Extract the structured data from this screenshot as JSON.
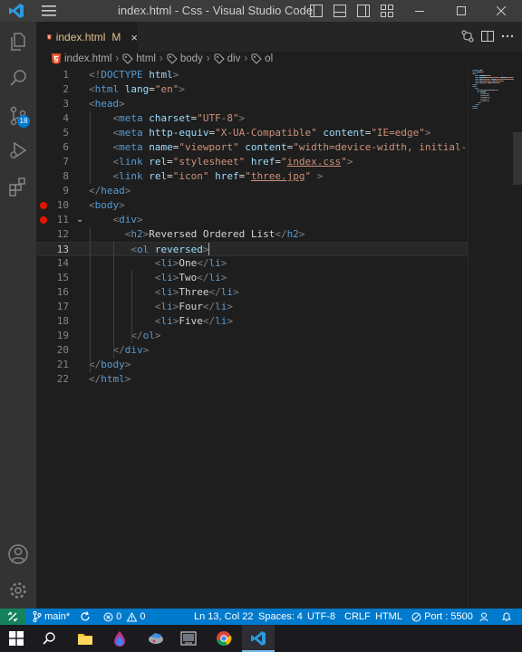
{
  "titlebar": {
    "title": "index.html - Css - Visual Studio Code"
  },
  "tab": {
    "label": "index.html",
    "modified": "M",
    "close": "×"
  },
  "breadcrumb": [
    "index.html",
    "html",
    "body",
    "div",
    "ol"
  ],
  "editor": {
    "current_line": 13,
    "line_numbers": [
      "1",
      "2",
      "3",
      "4",
      "5",
      "6",
      "7",
      "8",
      "9",
      "10",
      "11",
      "12",
      "13",
      "14",
      "15",
      "16",
      "17",
      "18",
      "19",
      "20",
      "21",
      "22"
    ],
    "breakpoint_lines": [
      10,
      11
    ],
    "folded_line": 11,
    "lines": [
      [
        [
          "p",
          "<!"
        ],
        [
          "t",
          "DOCTYPE"
        ],
        [
          "d",
          " "
        ],
        [
          "a",
          "html"
        ],
        [
          "p",
          ">"
        ]
      ],
      [
        [
          "p",
          "<"
        ],
        [
          "t",
          "html"
        ],
        [
          "d",
          " "
        ],
        [
          "a",
          "lang"
        ],
        [
          "d",
          "="
        ],
        [
          "s",
          "\"en\""
        ],
        [
          "p",
          ">"
        ]
      ],
      [
        [
          "p",
          "<"
        ],
        [
          "t",
          "head"
        ],
        [
          "p",
          ">"
        ]
      ],
      [
        [
          "d",
          "    "
        ],
        [
          "p",
          "<"
        ],
        [
          "t",
          "meta"
        ],
        [
          "d",
          " "
        ],
        [
          "a",
          "charset"
        ],
        [
          "d",
          "="
        ],
        [
          "s",
          "\"UTF-8\""
        ],
        [
          "p",
          ">"
        ]
      ],
      [
        [
          "d",
          "    "
        ],
        [
          "p",
          "<"
        ],
        [
          "t",
          "meta"
        ],
        [
          "d",
          " "
        ],
        [
          "a",
          "http-equiv"
        ],
        [
          "d",
          "="
        ],
        [
          "s",
          "\"X-UA-Compatible\""
        ],
        [
          "d",
          " "
        ],
        [
          "a",
          "content"
        ],
        [
          "d",
          "="
        ],
        [
          "s",
          "\"IE=edge\""
        ],
        [
          "p",
          ">"
        ]
      ],
      [
        [
          "d",
          "    "
        ],
        [
          "p",
          "<"
        ],
        [
          "t",
          "meta"
        ],
        [
          "d",
          " "
        ],
        [
          "a",
          "name"
        ],
        [
          "d",
          "="
        ],
        [
          "s",
          "\"viewport\""
        ],
        [
          "d",
          " "
        ],
        [
          "a",
          "content"
        ],
        [
          "d",
          "="
        ],
        [
          "s",
          "\"width=device-width, initial-sc"
        ]
      ],
      [
        [
          "d",
          "    "
        ],
        [
          "p",
          "<"
        ],
        [
          "t",
          "link"
        ],
        [
          "d",
          " "
        ],
        [
          "a",
          "rel"
        ],
        [
          "d",
          "="
        ],
        [
          "s",
          "\"stylesheet\""
        ],
        [
          "d",
          " "
        ],
        [
          "a",
          "href"
        ],
        [
          "d",
          "="
        ],
        [
          "s",
          "\""
        ],
        [
          "su",
          "index.css"
        ],
        [
          "s",
          "\""
        ],
        [
          "p",
          ">"
        ]
      ],
      [
        [
          "d",
          "    "
        ],
        [
          "p",
          "<"
        ],
        [
          "t",
          "link"
        ],
        [
          "d",
          " "
        ],
        [
          "a",
          "rel"
        ],
        [
          "d",
          "="
        ],
        [
          "s",
          "\"icon\""
        ],
        [
          "d",
          " "
        ],
        [
          "a",
          "href"
        ],
        [
          "d",
          "="
        ],
        [
          "s",
          "\""
        ],
        [
          "su",
          "three.jpg"
        ],
        [
          "s",
          "\""
        ],
        [
          "d",
          " "
        ],
        [
          "p",
          ">"
        ]
      ],
      [
        [
          "p",
          "</"
        ],
        [
          "t",
          "head"
        ],
        [
          "p",
          ">"
        ]
      ],
      [
        [
          "p",
          "<"
        ],
        [
          "t",
          "body"
        ],
        [
          "p",
          ">"
        ]
      ],
      [
        [
          "d",
          "    "
        ],
        [
          "p",
          "<"
        ],
        [
          "t",
          "div"
        ],
        [
          "p",
          ">"
        ]
      ],
      [
        [
          "d",
          "      "
        ],
        [
          "p",
          "<"
        ],
        [
          "t",
          "h2"
        ],
        [
          "p",
          ">"
        ],
        [
          "d",
          "Reversed Ordered List"
        ],
        [
          "p",
          "</"
        ],
        [
          "t",
          "h2"
        ],
        [
          "p",
          ">"
        ]
      ],
      [
        [
          "d",
          "       "
        ],
        [
          "p",
          "<"
        ],
        [
          "t",
          "ol"
        ],
        [
          "d",
          " "
        ],
        [
          "a",
          "reversed"
        ],
        [
          "p",
          ">"
        ]
      ],
      [
        [
          "d",
          "           "
        ],
        [
          "p",
          "<"
        ],
        [
          "t",
          "li"
        ],
        [
          "p",
          ">"
        ],
        [
          "d",
          "One"
        ],
        [
          "p",
          "</"
        ],
        [
          "t",
          "li"
        ],
        [
          "p",
          ">"
        ]
      ],
      [
        [
          "d",
          "           "
        ],
        [
          "p",
          "<"
        ],
        [
          "t",
          "li"
        ],
        [
          "p",
          ">"
        ],
        [
          "d",
          "Two"
        ],
        [
          "p",
          "</"
        ],
        [
          "t",
          "li"
        ],
        [
          "p",
          ">"
        ]
      ],
      [
        [
          "d",
          "           "
        ],
        [
          "p",
          "<"
        ],
        [
          "t",
          "li"
        ],
        [
          "p",
          ">"
        ],
        [
          "d",
          "Three"
        ],
        [
          "p",
          "</"
        ],
        [
          "t",
          "li"
        ],
        [
          "p",
          ">"
        ]
      ],
      [
        [
          "d",
          "           "
        ],
        [
          "p",
          "<"
        ],
        [
          "t",
          "li"
        ],
        [
          "p",
          ">"
        ],
        [
          "d",
          "Four"
        ],
        [
          "p",
          "</"
        ],
        [
          "t",
          "li"
        ],
        [
          "p",
          ">"
        ]
      ],
      [
        [
          "d",
          "           "
        ],
        [
          "p",
          "<"
        ],
        [
          "t",
          "li"
        ],
        [
          "p",
          ">"
        ],
        [
          "d",
          "Five"
        ],
        [
          "p",
          "</"
        ],
        [
          "t",
          "li"
        ],
        [
          "p",
          ">"
        ]
      ],
      [
        [
          "d",
          "       "
        ],
        [
          "p",
          "</"
        ],
        [
          "t",
          "ol"
        ],
        [
          "p",
          ">"
        ]
      ],
      [
        [
          "d",
          "    "
        ],
        [
          "p",
          "</"
        ],
        [
          "t",
          "div"
        ],
        [
          "p",
          ">"
        ]
      ],
      [
        [
          "p",
          "</"
        ],
        [
          "t",
          "body"
        ],
        [
          "p",
          ">"
        ]
      ],
      [
        [
          "p",
          "</"
        ],
        [
          "t",
          "html"
        ],
        [
          "p",
          ">"
        ]
      ]
    ]
  },
  "statusbar": {
    "branch": "main*",
    "errors": "0",
    "warnings": "0",
    "position": "Ln 13, Col 22",
    "spaces": "Spaces: 4",
    "encoding": "UTF-8",
    "eol": "CRLF",
    "language": "HTML",
    "port": "Port : 5500"
  },
  "colors": {
    "accent": "#007acc",
    "remote": "#16825d",
    "tag": "#569cd6",
    "attribute": "#9cdcfe",
    "string": "#ce9178",
    "modified": "#e2c08d",
    "breakpoint": "#e51400"
  },
  "icons": {
    "activity": [
      "explorer-icon",
      "search-icon",
      "source-control-icon",
      "run-debug-icon",
      "extensions-icon",
      "account-icon",
      "settings-icon"
    ],
    "taskbar": [
      "windows-start-icon",
      "search-icon",
      "file-explorer-icon",
      "app-icon",
      "app-icon",
      "app-icon",
      "chrome-icon",
      "vscode-icon"
    ]
  },
  "source_control_badge": "18"
}
